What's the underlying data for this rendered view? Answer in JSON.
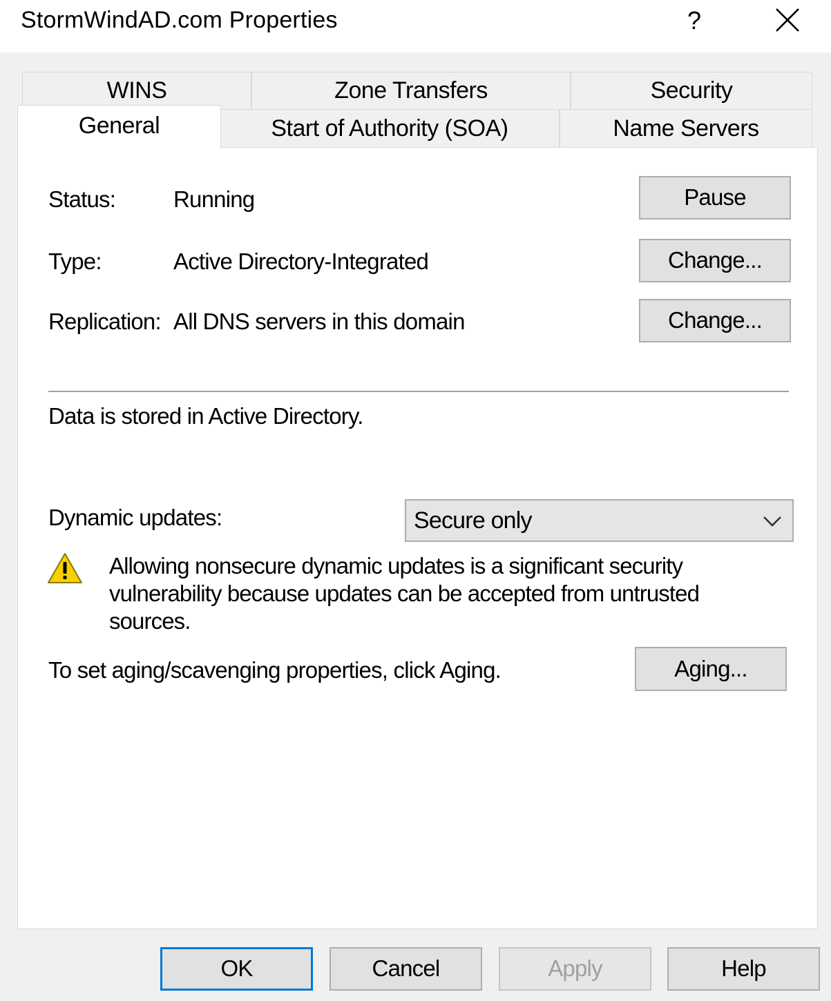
{
  "window": {
    "title": "StormWindAD.com Properties",
    "help_label": "?",
    "close_icon": "close-icon"
  },
  "tabs": {
    "row1": [
      {
        "label": "WINS"
      },
      {
        "label": "Zone Transfers"
      },
      {
        "label": "Security"
      }
    ],
    "row2": [
      {
        "label": "General",
        "active": true
      },
      {
        "label": "Start of Authority (SOA)"
      },
      {
        "label": "Name Servers"
      }
    ]
  },
  "general": {
    "status_label": "Status:",
    "status_value": "Running",
    "pause_button": "Pause",
    "type_label": "Type:",
    "type_value": "Active Directory-Integrated",
    "type_change_button": "Change...",
    "replication_label": "Replication:",
    "replication_value": "All DNS servers in this domain",
    "replication_change_button": "Change...",
    "storage_note": "Data is stored in Active Directory.",
    "dynamic_updates_label": "Dynamic updates:",
    "dynamic_updates_value": "Secure only",
    "warning_icon": "warning-icon",
    "warning_text": "Allowing nonsecure dynamic updates is a significant security vulnerability because updates can be accepted from untrusted sources.",
    "aging_text": "To set aging/scavenging properties, click Aging.",
    "aging_button": "Aging..."
  },
  "footer": {
    "ok": "OK",
    "cancel": "Cancel",
    "apply": "Apply",
    "help": "Help"
  },
  "colors": {
    "dialog_bg": "#f0f0f0",
    "panel_bg": "#ffffff",
    "button_bg": "#e1e1e1",
    "default_button_border": "#0078d7",
    "disabled_text": "#a0a0a0",
    "warning_yellow": "#f7d000"
  }
}
